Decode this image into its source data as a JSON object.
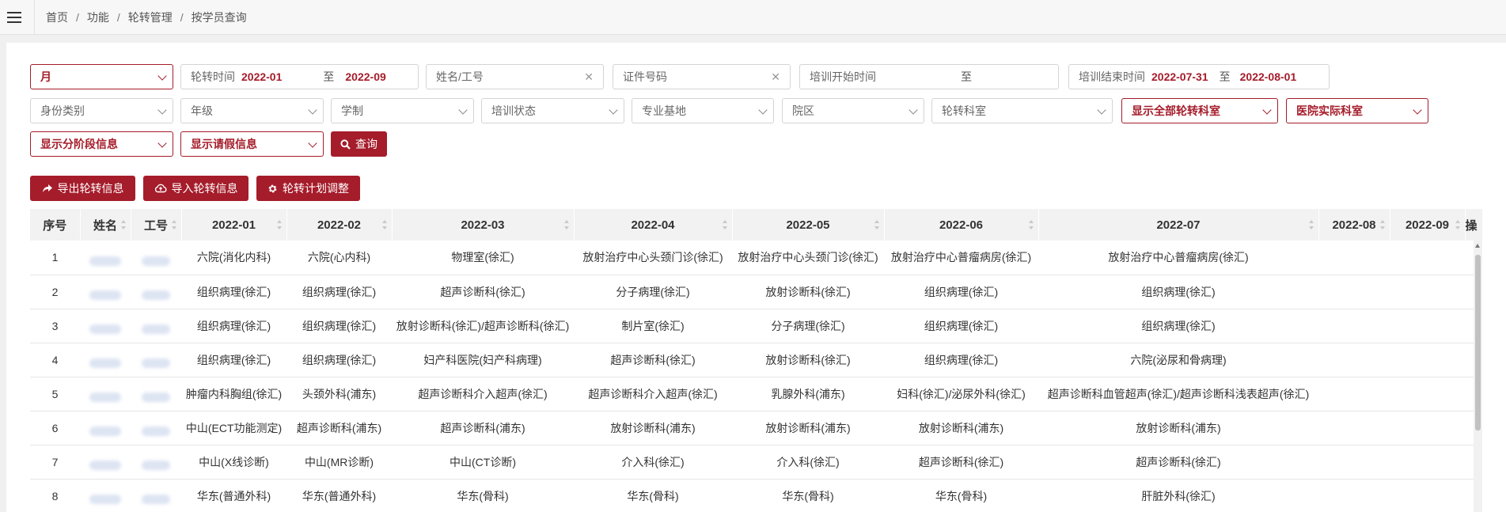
{
  "breadcrumb": [
    "首页",
    "功能",
    "轮转管理",
    "按学员查询"
  ],
  "colors": {
    "accent": "#a51c2a",
    "header_bg": "#f2f2f2"
  },
  "filters": {
    "period_select": "月",
    "rotation_time_label": "轮转时间",
    "rotation_from": "2022-01",
    "rotation_to_sep": "至",
    "rotation_to": "2022-09",
    "name_placeholder": "姓名/工号",
    "id_placeholder": "证件号码",
    "train_start_label": "培训开始时间",
    "train_start_sep": "至",
    "train_end_label": "培训结束时间",
    "train_end_from": "2022-07-31",
    "train_end_sep": "至",
    "train_end_to": "2022-08-01",
    "identity_type": "身份类别",
    "grade": "年级",
    "schooling": "学制",
    "train_status": "培训状态",
    "base": "专业基地",
    "campus": "院区",
    "rotation_dept": "轮转科室",
    "show_all_depts": "显示全部轮转科室",
    "hospital_dept": "医院实际科室",
    "show_stage": "显示分阶段信息",
    "show_leave": "显示请假信息",
    "query_button": "查询"
  },
  "actions": {
    "export": "导出轮转信息",
    "import": "导入轮转信息",
    "adjust": "轮转计划调整"
  },
  "table": {
    "headers": [
      "序号",
      "姓名",
      "工号",
      "2022-01",
      "2022-02",
      "2022-03",
      "2022-04",
      "2022-05",
      "2022-06",
      "2022-07",
      "2022-08",
      "2022-09",
      "操"
    ],
    "rows": [
      [
        "1",
        "六院(消化内科)",
        "六院(心内科)",
        "物理室(徐汇)",
        "放射治疗中心头颈门诊(徐汇)",
        "放射治疗中心头颈门诊(徐汇)",
        "放射治疗中心普瘤病房(徐汇)",
        "放射治疗中心普瘤病房(徐汇)"
      ],
      [
        "2",
        "组织病理(徐汇)",
        "组织病理(徐汇)",
        "超声诊断科(徐汇)",
        "分子病理(徐汇)",
        "放射诊断科(徐汇)",
        "组织病理(徐汇)",
        "组织病理(徐汇)"
      ],
      [
        "3",
        "组织病理(徐汇)",
        "组织病理(徐汇)",
        "放射诊断科(徐汇)/超声诊断科(徐汇)",
        "制片室(徐汇)",
        "分子病理(徐汇)",
        "组织病理(徐汇)",
        "组织病理(徐汇)"
      ],
      [
        "4",
        "组织病理(徐汇)",
        "组织病理(徐汇)",
        "妇产科医院(妇产科病理)",
        "超声诊断科(徐汇)",
        "放射诊断科(徐汇)",
        "组织病理(徐汇)",
        "六院(泌尿和骨病理)"
      ],
      [
        "5",
        "肿瘤内科胸组(徐汇)",
        "头颈外科(浦东)",
        "超声诊断科介入超声(徐汇)",
        "超声诊断科介入超声(徐汇)",
        "乳腺外科(浦东)",
        "妇科(徐汇)/泌尿外科(徐汇)",
        "超声诊断科血管超声(徐汇)/超声诊断科浅表超声(徐汇)"
      ],
      [
        "6",
        "中山(ECT功能测定)",
        "超声诊断科(浦东)",
        "超声诊断科(浦东)",
        "放射诊断科(浦东)",
        "放射诊断科(浦东)",
        "放射诊断科(浦东)",
        "放射诊断科(浦东)"
      ],
      [
        "7",
        "中山(X线诊断)",
        "中山(MR诊断)",
        "中山(CT诊断)",
        "介入科(徐汇)",
        "介入科(徐汇)",
        "超声诊断科(徐汇)",
        "超声诊断科(徐汇)"
      ],
      [
        "8",
        "华东(普通外科)",
        "华东(普通外科)",
        "华东(骨科)",
        "华东(骨科)",
        "华东(骨科)",
        "华东(骨科)",
        "肝脏外科(徐汇)"
      ]
    ]
  }
}
